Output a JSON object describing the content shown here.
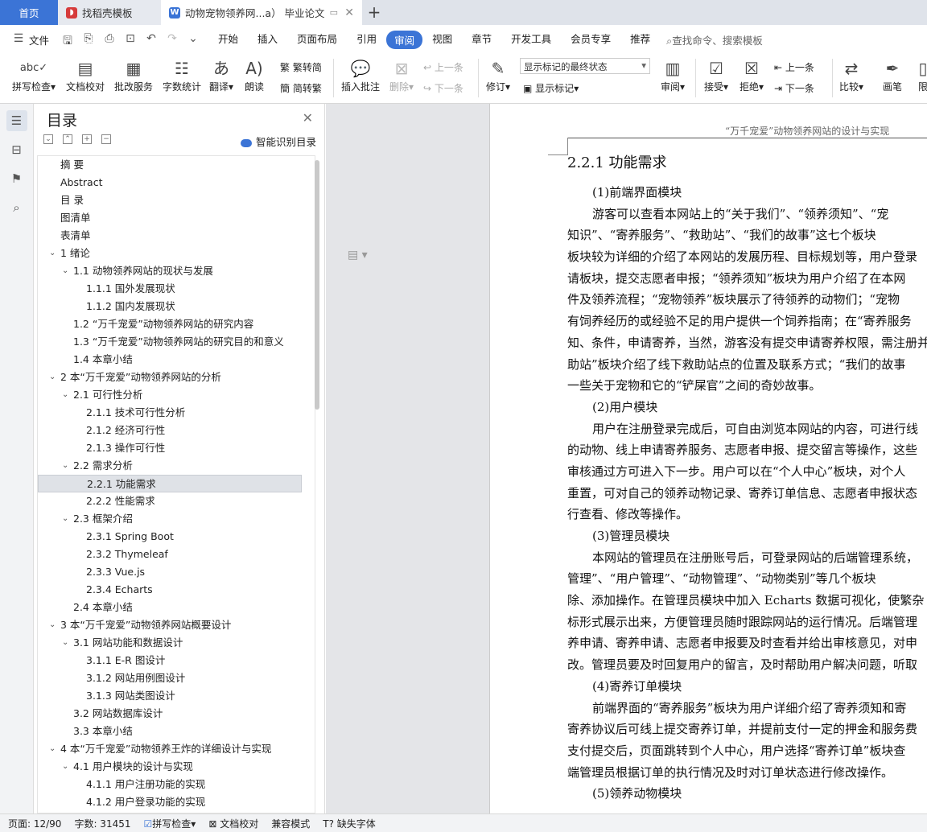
{
  "tabs": {
    "home": "首页",
    "template": "找稻壳模板",
    "doc": "动物宠物领养网...a）  毕业论文",
    "new": "+"
  },
  "menubar": {
    "file": "文件",
    "items": [
      "开始",
      "插入",
      "页面布局",
      "引用",
      "审阅",
      "视图",
      "章节",
      "开发工具",
      "会员专享",
      "推荐"
    ],
    "active": "审阅",
    "search": "查找命令、搜索模板"
  },
  "ribbon": {
    "spell": "拼写检查",
    "proof": "文档校对",
    "revise_service": "批改服务",
    "word_count": "字数统计",
    "translate": "翻译",
    "read": "朗读",
    "trad_simp": "繁转简",
    "simp_trad": "简转繁",
    "insert_comment": "插入批注",
    "delete": "删除",
    "prev_comment": "上一条",
    "next_comment": "下一条",
    "track": "修订",
    "markup_select": "显示标记的最终状态",
    "show_markup": "显示标记",
    "review": "审阅",
    "accept": "接受",
    "reject": "拒绝",
    "prev": "上一条",
    "next": "下一条",
    "compare": "比较",
    "ink": "画笔",
    "more": "限"
  },
  "toc": {
    "title": "目录",
    "smart": "智能识别目录",
    "items": [
      {
        "t": "摘    要",
        "lvl": 0
      },
      {
        "t": "Abstract",
        "lvl": 0
      },
      {
        "t": "目    录",
        "lvl": 0
      },
      {
        "t": "图清单",
        "lvl": 0
      },
      {
        "t": "表清单",
        "lvl": 0
      },
      {
        "t": "1  绪论",
        "lvl": 0,
        "car": 1
      },
      {
        "t": "1.1  动物领养网站的现状与发展",
        "lvl": 1,
        "car": 1
      },
      {
        "t": "1.1.1  国外发展现状",
        "lvl": 2
      },
      {
        "t": "1.1.2  国内发展现状",
        "lvl": 2
      },
      {
        "t": "1.2  “万千宠爱”动物领养网站的研究内容",
        "lvl": 1
      },
      {
        "t": "1.3  “万千宠爱”动物领养网站的研究目的和意义",
        "lvl": 1
      },
      {
        "t": "1.4  本章小结",
        "lvl": 1
      },
      {
        "t": "2  本“万千宠爱”动物领养网站的分析",
        "lvl": 0,
        "car": 1
      },
      {
        "t": "2.1  可行性分析",
        "lvl": 1,
        "car": 1
      },
      {
        "t": "2.1.1  技术可行性分析",
        "lvl": 2
      },
      {
        "t": "2.1.2  经济可行性",
        "lvl": 2
      },
      {
        "t": "2.1.3  操作可行性",
        "lvl": 2
      },
      {
        "t": "2.2  需求分析",
        "lvl": 1,
        "car": 1
      },
      {
        "t": "2.2.1  功能需求",
        "lvl": 2,
        "sel": 1
      },
      {
        "t": "2.2.2  性能需求",
        "lvl": 2
      },
      {
        "t": "2.3  框架介绍",
        "lvl": 1,
        "car": 1
      },
      {
        "t": "2.3.1 Spring Boot",
        "lvl": 2
      },
      {
        "t": "2.3.2 Thymeleaf",
        "lvl": 2
      },
      {
        "t": "2.3.3 Vue.js",
        "lvl": 2
      },
      {
        "t": "2.3.4 Echarts",
        "lvl": 2
      },
      {
        "t": "2.4  本章小结",
        "lvl": 1
      },
      {
        "t": "3  本“万千宠爱”动物领养网站概要设计",
        "lvl": 0,
        "car": 1
      },
      {
        "t": "3.1  网站功能和数据设计",
        "lvl": 1,
        "car": 1
      },
      {
        "t": "3.1.1 E-R 图设计",
        "lvl": 2
      },
      {
        "t": "3.1.2  网站用例图设计",
        "lvl": 2
      },
      {
        "t": "3.1.3  网站类图设计",
        "lvl": 2
      },
      {
        "t": "3.2  网站数据库设计",
        "lvl": 1
      },
      {
        "t": "3.3  本章小结",
        "lvl": 1
      },
      {
        "t": "4  本“万千宠爱”动物领养王炸的详细设计与实现",
        "lvl": 0,
        "car": 1
      },
      {
        "t": "4.1  用户模块的设计与实现",
        "lvl": 1,
        "car": 1
      },
      {
        "t": "4.1.1  用户注册功能的实现",
        "lvl": 2
      },
      {
        "t": "4.1.2  用户登录功能的实现",
        "lvl": 2
      }
    ]
  },
  "document": {
    "header": "“万千宠爱”动物领养网站的设计与实现",
    "heading": "2.2.1  功能需求",
    "lines": [
      {
        "t": "(1)前端界面模块",
        "ind": 1
      },
      {
        "t": "游客可以查看本网站上的“关于我们”、“领养须知”、“宠",
        "ind": 1
      },
      {
        "t": "知识”、“寄养服务”、“救助站”、“我们的故事”这七个板块",
        "ind": 0
      },
      {
        "t": "板块较为详细的介绍了本网站的发展历程、目标规划等，用户登录",
        "ind": 0
      },
      {
        "t": "请板块，提交志愿者申报；“领养须知”板块为用户介绍了在本网",
        "ind": 0
      },
      {
        "t": "件及领养流程；“宠物领养”板块展示了待领养的动物们；“宠物",
        "ind": 0
      },
      {
        "t": "有饲养经历的或经验不足的用户提供一个饲养指南；在“寄养服务",
        "ind": 0
      },
      {
        "t": "知、条件，申请寄养，当然，游客没有提交申请寄养权限，需注册并",
        "ind": 0
      },
      {
        "t": "助站”板块介绍了线下救助站点的位置及联系方式；“我们的故事",
        "ind": 0
      },
      {
        "t": "一些关于宠物和它的“铲屎官”之间的奇妙故事。",
        "ind": 0
      },
      {
        "t": "(2)用户模块",
        "ind": 1
      },
      {
        "t": "用户在注册登录完成后，可自由浏览本网站的内容，可进行线",
        "ind": 1
      },
      {
        "t": "的动物、线上申请寄养服务、志愿者申报、提交留言等操作，这些",
        "ind": 0
      },
      {
        "t": "审核通过方可进入下一步。用户可以在“个人中心”板块，对个人",
        "ind": 0
      },
      {
        "t": "重置，可对自己的领养动物记录、寄养订单信息、志愿者申报状态",
        "ind": 0
      },
      {
        "t": "行查看、修改等操作。",
        "ind": 0
      },
      {
        "t": "(3)管理员模块",
        "ind": 1
      },
      {
        "t": "本网站的管理员在注册账号后，可登录网站的后端管理系统，",
        "ind": 1
      },
      {
        "t": "管理”、“用户管理”、“动物管理”、“动物类别”等几个板块",
        "ind": 0
      },
      {
        "t": "除、添加操作。在管理员模块中加入 Echarts 数据可视化，使繁杂",
        "ind": 0
      },
      {
        "t": "标形式展示出来，方便管理员随时跟踪网站的运行情况。后端管理",
        "ind": 0
      },
      {
        "t": "养申请、寄养申请、志愿者申报要及时查看并给出审核意见，对申",
        "ind": 0
      },
      {
        "t": "改。管理员要及时回复用户的留言，及时帮助用户解决问题，听取",
        "ind": 0
      },
      {
        "t": "(4)寄养订单模块",
        "ind": 1
      },
      {
        "t": "前端界面的“寄养服务”板块为用户详细介绍了寄养须知和寄",
        "ind": 1
      },
      {
        "t": "寄养协议后可线上提交寄养订单，并提前支付一定的押金和服务费",
        "ind": 0
      },
      {
        "t": "支付提交后，页面跳转到个人中心，用户选择“寄养订单”板块查",
        "ind": 0
      },
      {
        "t": "端管理员根据订单的执行情况及时对订单状态进行修改操作。",
        "ind": 0
      },
      {
        "t": "(5)领养动物模块",
        "ind": 1
      }
    ]
  },
  "status": {
    "page": "页面: 12/90",
    "words": "字数: 31451",
    "spell": "拼写检查",
    "proof": "文档校对",
    "compat": "兼容模式",
    "font": "缺失字体"
  },
  "colors": {
    "accent": "#3b74d6",
    "canvas": "#e4e5e8"
  }
}
